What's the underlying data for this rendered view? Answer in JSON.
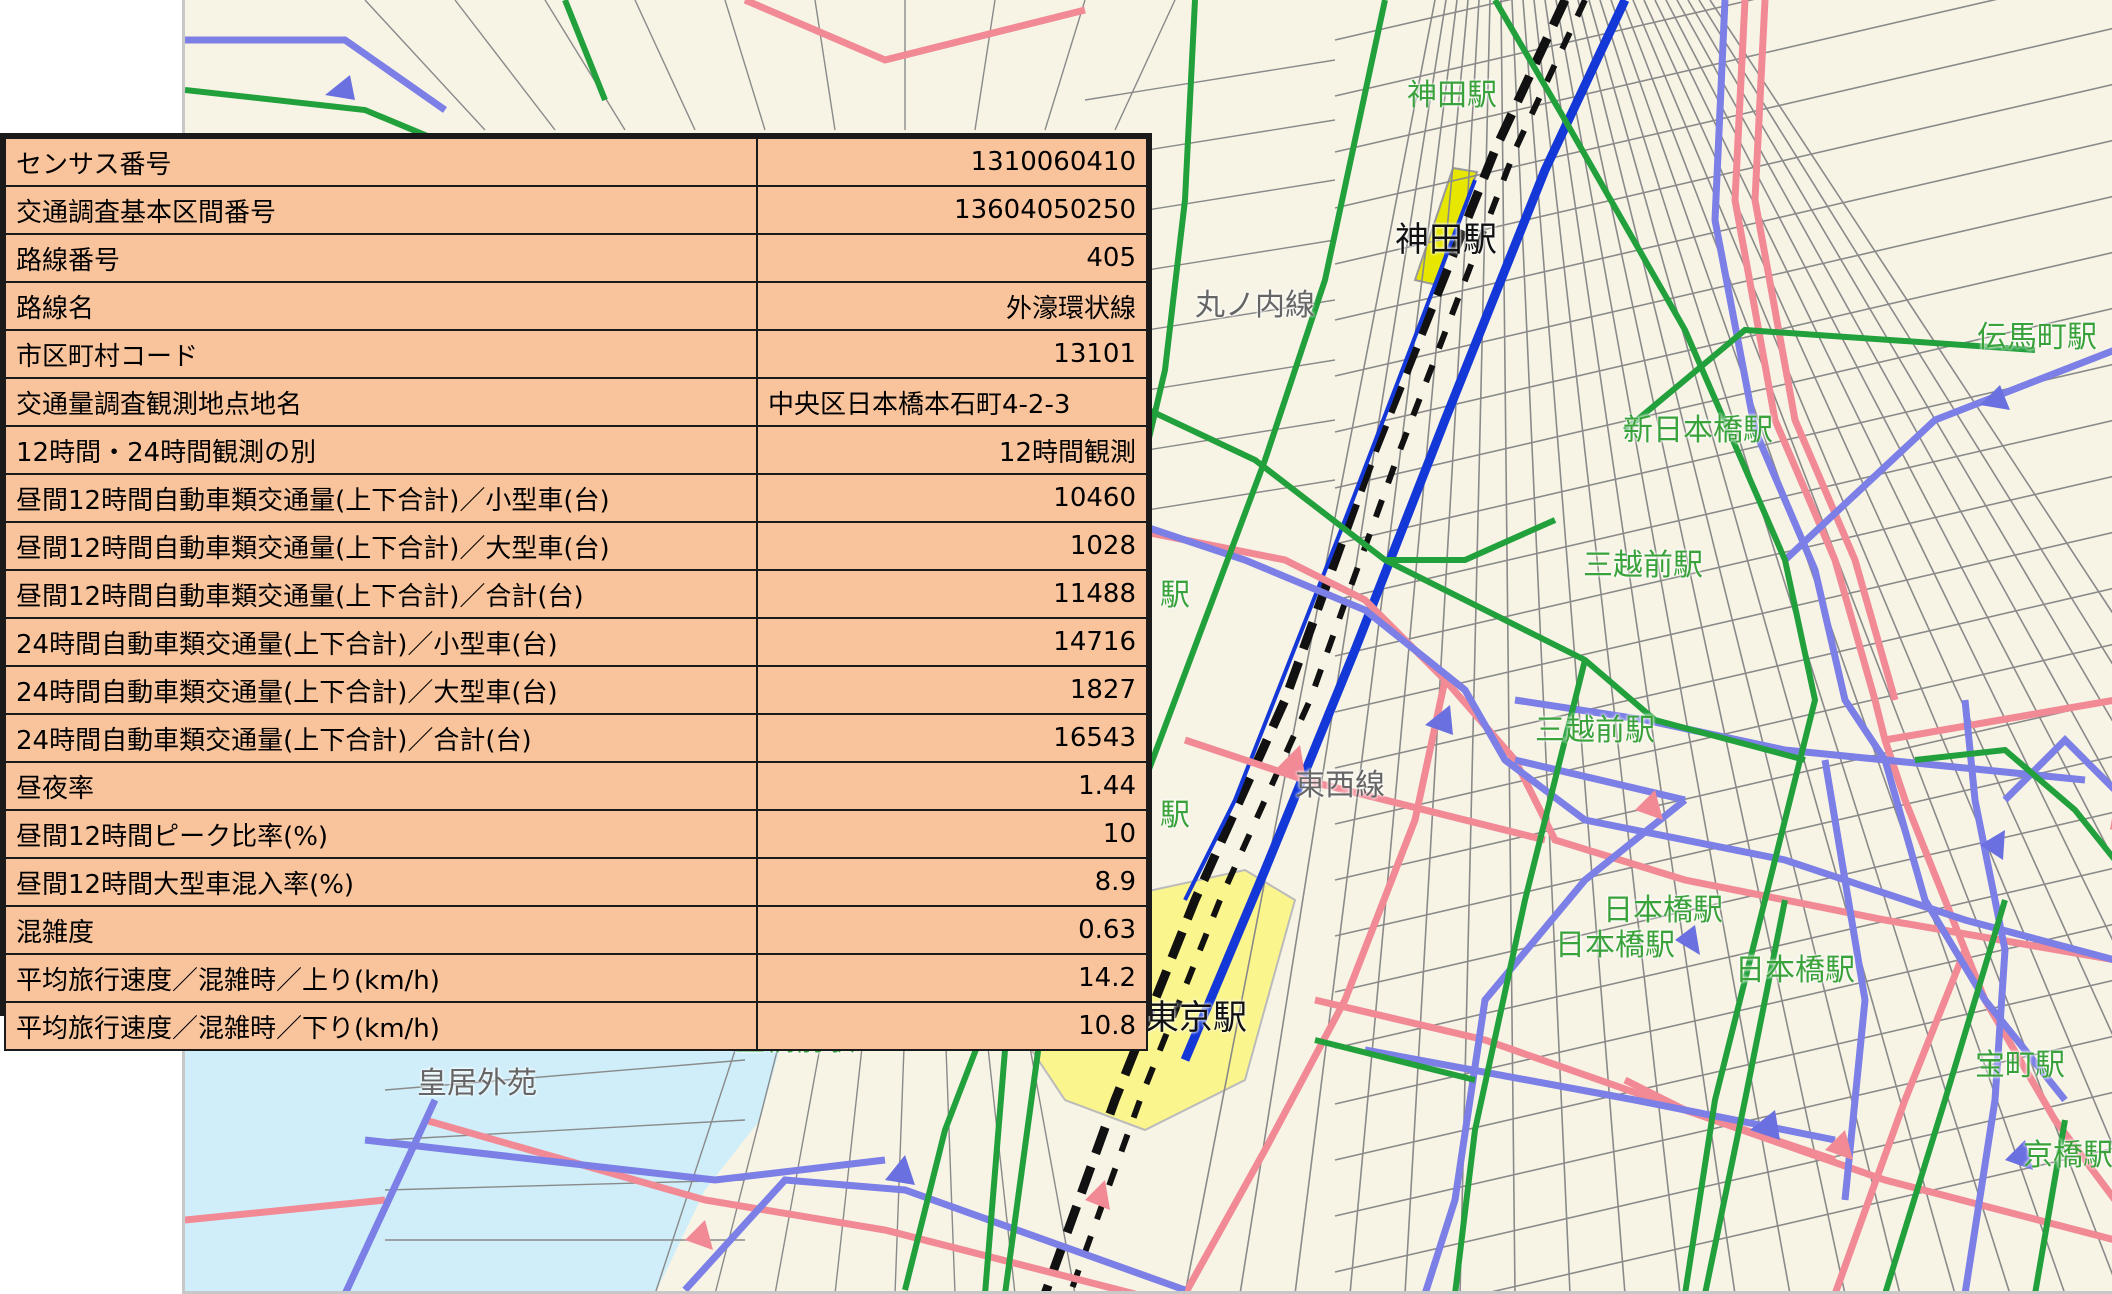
{
  "map": {
    "labels": {
      "kanda_station": "神田駅",
      "kanda_station_upper": "神田駅",
      "tokyo_station": "東京駅",
      "shin_nihombashi": "新日本橋駅",
      "mitsukoshimae_1": "三越前駅",
      "mitsukoshimae_2": "三越前駅",
      "nihombashi_1": "日本橋駅",
      "nihombashi_2": "日本橋駅",
      "nihombashi_3": "日本橋駅",
      "denmacho": "伝馬町駅",
      "nijubashimae": "二重橋前駅",
      "kokyo_gaien": "皇居外苑",
      "ote_line": "丸ノ内線",
      "tozai_line": "東西線",
      "station_left": "駅",
      "station_left2": "駅",
      "station_bottom_right": "宝町駅",
      "station_far_right": "京橋駅"
    },
    "colors": {
      "background": "#f7f4e6",
      "water": "#cfeefa",
      "station_fill": "#faf58c",
      "road_pink": "#f28a96",
      "road_purple": "#7b7fe6",
      "rail_green": "#22a03c",
      "rail_blue": "#1438d8",
      "street": "#8a8a8a"
    }
  },
  "info_table": {
    "rows": [
      {
        "label": "センサス番号",
        "value": "1310060410"
      },
      {
        "label": "交通調査基本区間番号",
        "value": "13604050250"
      },
      {
        "label": "路線番号",
        "value": "405"
      },
      {
        "label": "路線名",
        "value": "外濠環状線"
      },
      {
        "label": "市区町村コード",
        "value": "13101"
      },
      {
        "label": "交通量調査観測地点地名",
        "value": "中央区日本橋本石町4-2-3"
      },
      {
        "label": "12時間・24時間観測の別",
        "value": "12時間観測"
      },
      {
        "label": "昼間12時間自動車類交通量(上下合計)／小型車(台)",
        "value": "10460"
      },
      {
        "label": "昼間12時間自動車類交通量(上下合計)／大型車(台)",
        "value": "1028"
      },
      {
        "label": "昼間12時間自動車類交通量(上下合計)／合計(台)",
        "value": "11488"
      },
      {
        "label": "24時間自動車類交通量(上下合計)／小型車(台)",
        "value": "14716"
      },
      {
        "label": "24時間自動車類交通量(上下合計)／大型車(台)",
        "value": "1827"
      },
      {
        "label": "24時間自動車類交通量(上下合計)／合計(台)",
        "value": "16543"
      },
      {
        "label": "昼夜率",
        "value": "1.44"
      },
      {
        "label": "昼間12時間ピーク比率(%)",
        "value": "10"
      },
      {
        "label": "昼間12時間大型車混入率(%)",
        "value": "8.9"
      },
      {
        "label": "混雑度",
        "value": "0.63"
      },
      {
        "label": "平均旅行速度／混雑時／上り(km/h)",
        "value": "14.2"
      },
      {
        "label": "平均旅行速度／混雑時／下り(km/h)",
        "value": "10.8"
      }
    ]
  }
}
